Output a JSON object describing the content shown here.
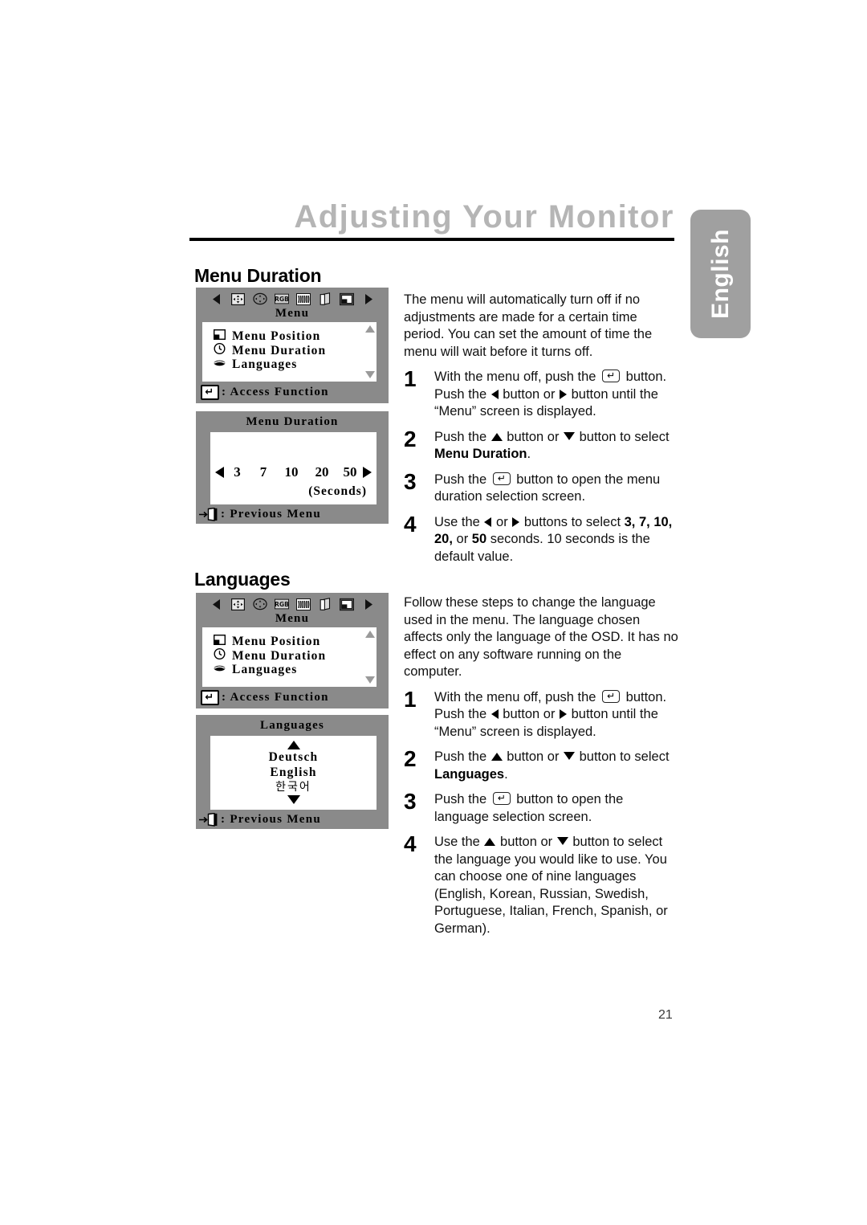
{
  "header": {
    "title": "Adjusting Your Monitor",
    "language_tab": "English",
    "page_number": "21"
  },
  "sections": [
    {
      "id": "menu-duration",
      "heading": "Menu Duration",
      "intro": "The menu will automatically turn off if no adjustments are made for a certain time period. You can set the amount of time the menu will wait before it turns off.",
      "steps": [
        {
          "num": "1",
          "text_parts": [
            "With the menu off, push the ",
            " button. Push the ",
            " button or ",
            " button until the “Menu” screen is displayed."
          ]
        },
        {
          "num": "2",
          "text_parts": [
            "Push the ",
            " button or ",
            " button to select ",
            "Menu Duration",
            "."
          ]
        },
        {
          "num": "3",
          "text_parts": [
            "Push the ",
            " button to open the menu duration selection screen."
          ]
        },
        {
          "num": "4",
          "text_parts": [
            "Use the ",
            " or ",
            " buttons to select ",
            "3, 7, 10, 20,",
            " or ",
            "50",
            " seconds. 10 seconds is the default value."
          ]
        }
      ],
      "osd_menu": {
        "title": "Menu",
        "items": [
          {
            "icon": "menu-position-icon",
            "label": "Menu Position"
          },
          {
            "icon": "clock-icon",
            "label": "Menu Duration"
          },
          {
            "icon": "languages-icon",
            "label": "Languages"
          }
        ],
        "footer": ": Access Function",
        "icons": [
          "left-arrow-icon",
          "position-icon",
          "geometry-icon",
          "rgb-icon",
          "moire-icon",
          "pages-icon",
          "osd-menu-icon",
          "right-arrow-icon"
        ]
      },
      "osd_detail": {
        "title": "Menu Duration",
        "values": [
          "3",
          "7",
          "10",
          "20",
          "50"
        ],
        "unit": "(Seconds)",
        "footer": ": Previous Menu"
      }
    },
    {
      "id": "languages",
      "heading": "Languages",
      "intro": "Follow these steps to change the language used in the menu. The language chosen affects only the language of the OSD. It has no effect on any software running on the computer.",
      "steps": [
        {
          "num": "1",
          "text_parts": [
            "With the menu off, push the ",
            " button. Push the ",
            " button or ",
            " button until the “Menu” screen is displayed."
          ]
        },
        {
          "num": "2",
          "text_parts": [
            "Push the ",
            " button or ",
            " button to select ",
            "Languages",
            "."
          ]
        },
        {
          "num": "3",
          "text_parts": [
            "Push the ",
            " button to open the language selection screen."
          ]
        },
        {
          "num": "4",
          "text_parts": [
            "Use the ",
            " button or ",
            " button to select the language you would like to use. You can choose one of nine languages (English, Korean, Russian, Swedish, Portuguese, Italian, French, Spanish, or German)."
          ]
        }
      ],
      "osd_menu": {
        "title": "Menu",
        "items": [
          {
            "icon": "menu-position-icon",
            "label": "Menu Position"
          },
          {
            "icon": "clock-icon",
            "label": "Menu Duration"
          },
          {
            "icon": "languages-icon",
            "label": "Languages"
          }
        ],
        "footer": ": Access Function",
        "icons": [
          "left-arrow-icon",
          "position-icon",
          "geometry-icon",
          "rgb-icon",
          "moire-icon",
          "pages-icon",
          "osd-menu-icon",
          "right-arrow-icon"
        ]
      },
      "osd_detail": {
        "title": "Languages",
        "options": [
          "Deutsch",
          "English",
          "한국어"
        ],
        "footer": ": Previous Menu"
      }
    }
  ],
  "colors": {
    "osd_background": "#8a8a8a",
    "osd_panel": "#ffffff",
    "title_gray": "#b5b5b5",
    "tab_gray": "#a0a0a0"
  }
}
